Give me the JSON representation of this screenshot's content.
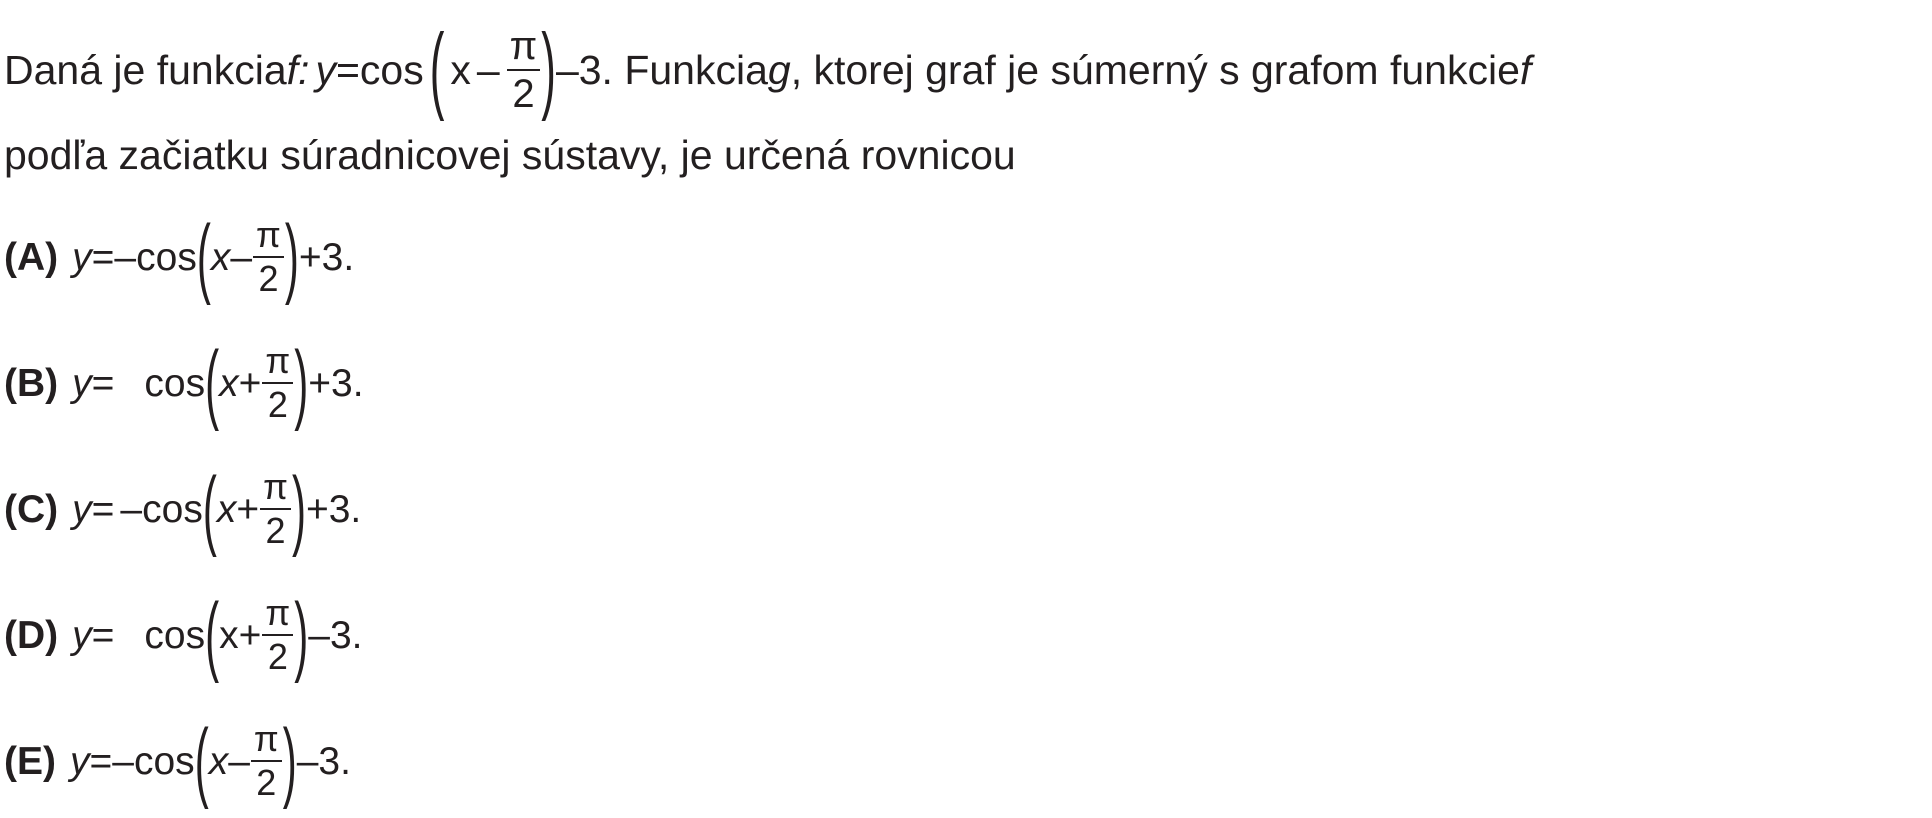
{
  "problem": {
    "intro": "Daná je funkcia ",
    "f_name": "f",
    "colon": ":",
    "y": "y",
    "eq": "=",
    "cos": "cos",
    "lparen": "(",
    "x": "x",
    "minus": "–",
    "pi": "π",
    "two": "2",
    "rparen": ")",
    "tail": "–3. Funkcia ",
    "g_name": "g",
    "mid": ", ktorej graf je súmerný s grafom funkcie ",
    "f2": "f",
    "line2": "podľa začiatku súradnicovej sústavy, je určená rovnicou"
  },
  "options": [
    {
      "label": "(A)",
      "y": "y",
      "eq": "=",
      "sign": "–",
      "cos": "cos",
      "lparen": "(",
      "x": "x",
      "op": "–",
      "pi": "π",
      "two": "2",
      "rparen": ")",
      "tail": "+3."
    },
    {
      "label": "(B)",
      "y": "y",
      "eq": "=",
      "sign": "",
      "cos": "cos",
      "lparen": "(",
      "x": "x",
      "op": "+",
      "pi": "π",
      "two": "2",
      "rparen": ")",
      "tail": "+3."
    },
    {
      "label": "(C)",
      "y": "y",
      "eq": "=",
      "sign": "–",
      "cos": "cos",
      "lparen": "(",
      "x": "x",
      "op": "+",
      "pi": "π",
      "two": "2",
      "rparen": ")",
      "tail": "+3."
    },
    {
      "label": "(D)",
      "y": "y",
      "eq": "=",
      "sign": "",
      "cos": "cos",
      "lparen": "(",
      "x": "x",
      "op": "+",
      "pi": "π",
      "two": "2",
      "rparen": ")",
      "tail": "–3."
    },
    {
      "label": "(E)",
      "y": "y",
      "eq": "=",
      "sign": "–",
      "cos": "cos",
      "lparen": "(",
      "x": "x",
      "op": "–",
      "pi": "π",
      "two": "2",
      "rparen": ")",
      "tail": "–3."
    }
  ]
}
